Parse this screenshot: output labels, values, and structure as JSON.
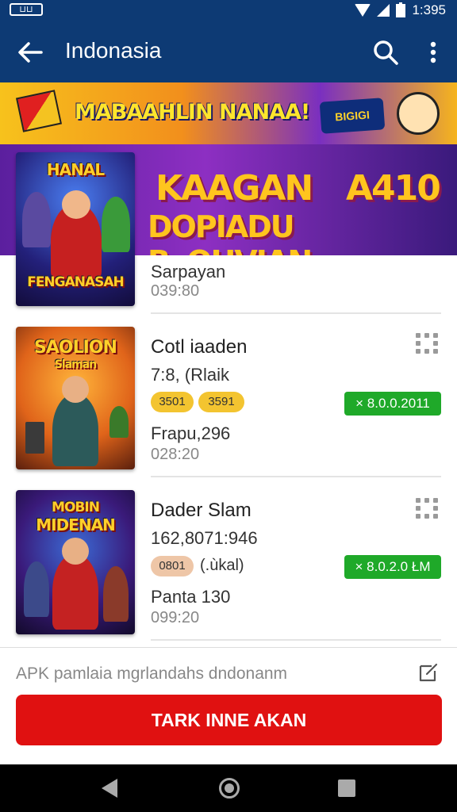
{
  "status_bar": {
    "time": "1:395",
    "left_badge": "⊔⊔"
  },
  "app_bar": {
    "title": "Indonasia"
  },
  "banner": {
    "text": "MABAAHLIN NANAA!",
    "logo_text": "BIGIGI"
  },
  "hero": {
    "line1": "KAAGAN",
    "line1_right": "A410",
    "line2": "DOPIADU B•OHVIAN"
  },
  "items": [
    {
      "thumb_caption_top": "HANAL",
      "thumb_caption": "FENGANASAH",
      "sub": "Sarpayan",
      "time": "039:80"
    },
    {
      "thumb_caption": "SAOLION",
      "thumb_caption_2": "Slaman",
      "name": "Cotl iaaden",
      "sub": "7:8, (Rlaik",
      "chips": [
        "3501",
        "3591"
      ],
      "price": "× 8.0.0.2011",
      "extra": "Frapu,296",
      "time": "028:20"
    },
    {
      "thumb_caption": "MOBIN",
      "thumb_caption_2": "MIDENAN",
      "name": "Dader Slam",
      "sub": "162,8071:946",
      "chips": [
        "0801"
      ],
      "chip_note": "(.ùkal)",
      "price": "× 8.0.2.0 ŁM",
      "extra": "Panta 130",
      "time": "099:20"
    }
  ],
  "footer": {
    "text": "APK pamlaia mgrlandahs dndonanm"
  },
  "cta": {
    "label": "TARK INNE AKAN"
  },
  "colors": {
    "primary": "#0d3a74",
    "cta": "#e01111",
    "price": "#1fa929",
    "chip": "#f3c430"
  }
}
